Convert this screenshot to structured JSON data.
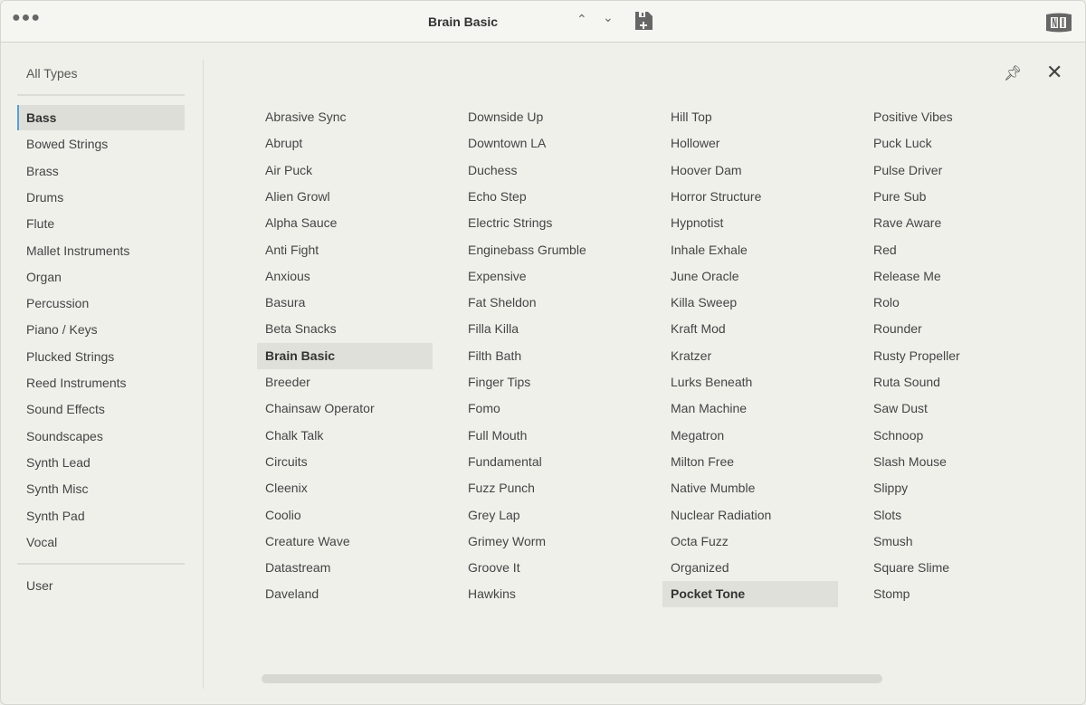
{
  "header": {
    "title": "Brain Basic",
    "menu_icon": "more-dots-icon",
    "prev_icon": "chevron-up-icon",
    "next_icon": "chevron-down-icon",
    "save_icon": "save-icon",
    "logo": "NI"
  },
  "sidebar": {
    "all_types": "All Types",
    "selected": "Bass",
    "categories": [
      "Bass",
      "Bowed Strings",
      "Brass",
      "Drums",
      "Flute",
      "Mallet Instruments",
      "Organ",
      "Percussion",
      "Piano / Keys",
      "Plucked Strings",
      "Reed Instruments",
      "Sound Effects",
      "Soundscapes",
      "Synth Lead",
      "Synth Misc",
      "Synth Pad",
      "Vocal"
    ],
    "user": "User"
  },
  "presets": {
    "selected": [
      "Brain Basic",
      "Pocket Tone"
    ],
    "columns": [
      [
        "Abrasive Sync",
        "Abrupt",
        "Air Puck",
        "Alien Growl",
        "Alpha Sauce",
        "Anti Fight",
        "Anxious",
        "Basura",
        "Beta Snacks",
        "Brain Basic",
        "Breeder",
        "Chainsaw Operator",
        "Chalk Talk",
        "Circuits",
        "Cleenix",
        "Coolio",
        "Creature Wave",
        "Datastream",
        "Daveland"
      ],
      [
        "Downside Up",
        "Downtown LA",
        "Duchess",
        "Echo Step",
        "Electric Strings",
        "Enginebass Grumble",
        "Expensive",
        "Fat Sheldon",
        "Filla Killa",
        "Filth Bath",
        "Finger Tips",
        "Fomo",
        "Full Mouth",
        "Fundamental",
        "Fuzz Punch",
        "Grey Lap",
        "Grimey Worm",
        "Groove It",
        "Hawkins"
      ],
      [
        "Hill Top",
        "Hollower",
        "Hoover Dam",
        "Horror Structure",
        "Hypnotist",
        "Inhale Exhale",
        "June Oracle",
        "Killa Sweep",
        "Kraft Mod",
        "Kratzer",
        "Lurks Beneath",
        "Man Machine",
        "Megatron",
        "Milton Free",
        "Native Mumble",
        "Nuclear Radiation",
        "Octa Fuzz",
        "Organized",
        "Pocket Tone"
      ],
      [
        "Positive Vibes",
        "Puck Luck",
        "Pulse Driver",
        "Pure Sub",
        "Rave Aware",
        "Red",
        "Release Me",
        "Rolo",
        "Rounder",
        "Rusty Propeller",
        "Ruta Sound",
        "Saw Dust",
        "Schnoop",
        "Slash Mouse",
        "Slippy",
        "Slots",
        "Smush",
        "Square Slime",
        "Stomp"
      ]
    ]
  },
  "colors": {
    "accent": "#5a9fd6",
    "selection": "#e0e0da"
  }
}
